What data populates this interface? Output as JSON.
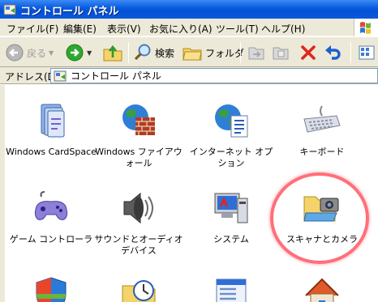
{
  "window": {
    "title": "コントロール パネル"
  },
  "menu": {
    "items": [
      {
        "label": "ファイル(F)"
      },
      {
        "label": "編集(E)"
      },
      {
        "label": "表示(V)"
      },
      {
        "label": "お気に入り(A)"
      },
      {
        "label": "ツール(T)"
      },
      {
        "label": "ヘルプ(H)"
      }
    ]
  },
  "toolbar": {
    "back_label": "戻る",
    "search_label": "検索",
    "folders_label": "フォルダ"
  },
  "address": {
    "label": "アドレス(D)",
    "value": "コントロール パネル"
  },
  "items": [
    {
      "label": "Windows CardSpace",
      "icon": "cardspace-icon"
    },
    {
      "label": "Windows ファイアウォール",
      "icon": "firewall-icon"
    },
    {
      "label": "インターネット オプション",
      "icon": "internet-options-icon"
    },
    {
      "label": "キーボード",
      "icon": "keyboard-icon"
    },
    {
      "label": "ゲーム コントローラ",
      "icon": "game-controller-icon"
    },
    {
      "label": "サウンドとオーディオ デバイス",
      "icon": "speaker-icon"
    },
    {
      "label": "システム",
      "icon": "system-icon"
    },
    {
      "label": "スキャナとカメラ",
      "icon": "scanner-camera-icon"
    }
  ],
  "colors": {
    "titlebar": "#0a5ee0",
    "chrome": "#ece9d8",
    "highlight": "#ff6f7a"
  }
}
